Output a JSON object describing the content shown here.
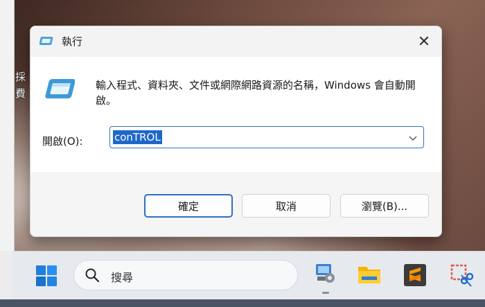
{
  "desktop": {
    "fragments": [
      "採",
      "費"
    ]
  },
  "dialog": {
    "title": "執行",
    "close_glyph": "✕",
    "description": "輸入程式、資料夾、文件或網際網路資源的名稱，Windows 會自動開啟。",
    "open_label": "開啟(O):",
    "open_value": "conTROL",
    "buttons": {
      "ok": "確定",
      "cancel": "取消",
      "browse": "瀏覽(B)..."
    }
  },
  "taskbar": {
    "search_placeholder": "搜尋",
    "apps": [
      "start-icon",
      "control-panel-icon",
      "file-explorer-icon",
      "sublime-text-icon",
      "snipping-tool-icon"
    ]
  },
  "colors": {
    "accent": "#1e67c8",
    "dialog_bg": "#f5f5f5",
    "taskbar_bg": "#e6e9ee"
  }
}
